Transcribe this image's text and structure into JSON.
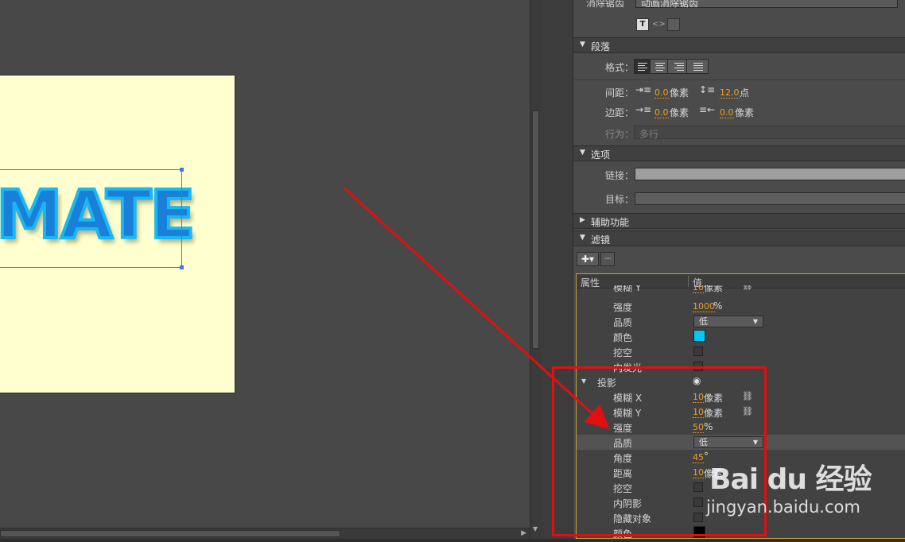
{
  "stage": {
    "text": "MATE",
    "canvas_color": "#ffffd0",
    "text_color": "#1a7fd8",
    "text_glow_color": "#18b8f2"
  },
  "panel": {
    "anti_alias": {
      "label": "消除锯齿",
      "value": "动画消除锯齿"
    },
    "paragraph": {
      "title": "段落",
      "format_label": "格式：",
      "spacing_label": "间距：",
      "indent_value": "0.0",
      "indent_unit": "像素",
      "line_spacing_value": "12.0",
      "line_spacing_unit": "点",
      "margin_label": "边距：",
      "left_margin_value": "0.0",
      "left_margin_unit": "像素",
      "right_margin_value": "0.0",
      "right_margin_unit": "像素",
      "behavior_label": "行为：",
      "behavior_value": "多行"
    },
    "options": {
      "title": "选项",
      "link_label": "链接：",
      "target_label": "目标："
    },
    "accessibility": {
      "title": "辅助功能"
    },
    "filters": {
      "title": "滤镜",
      "col_property": "属性",
      "col_value": "值",
      "glow": {
        "blur_y_label": "模糊 Y",
        "blur_y_value": "10",
        "blur_y_unit": "像素",
        "strength_label": "强度",
        "strength_value": "1000",
        "strength_unit": "%",
        "quality_label": "品质",
        "quality_value": "低",
        "color_label": "颜色",
        "color_value": "#00c8f8",
        "knockout_label": "挖空",
        "inner_glow_label": "内发光"
      },
      "drop_shadow": {
        "title": "投影",
        "blur_x_label": "模糊 X",
        "blur_x_value": "10",
        "blur_x_unit": "像素",
        "blur_y_label": "模糊 Y",
        "blur_y_value": "10",
        "blur_y_unit": "像素",
        "strength_label": "强度",
        "strength_value": "50",
        "strength_unit": "%",
        "quality_label": "品质",
        "quality_value": "低",
        "angle_label": "角度",
        "angle_value": "45",
        "angle_unit": "°",
        "distance_label": "距离",
        "distance_value": "10",
        "distance_unit": "像素",
        "knockout_label": "挖空",
        "inner_shadow_label": "内阴影",
        "hide_object_label": "隐藏对象",
        "color_label": "颜色",
        "color_value": "#000000"
      }
    }
  },
  "watermark": {
    "logo": "Bai du 经验",
    "url": "jingyan.baidu.com"
  },
  "colors": {
    "panel_bg": "#4b4b4b",
    "accent_orange": "#f0a020",
    "annotation_red": "#e01010",
    "selection_blue": "#3a7be0"
  }
}
